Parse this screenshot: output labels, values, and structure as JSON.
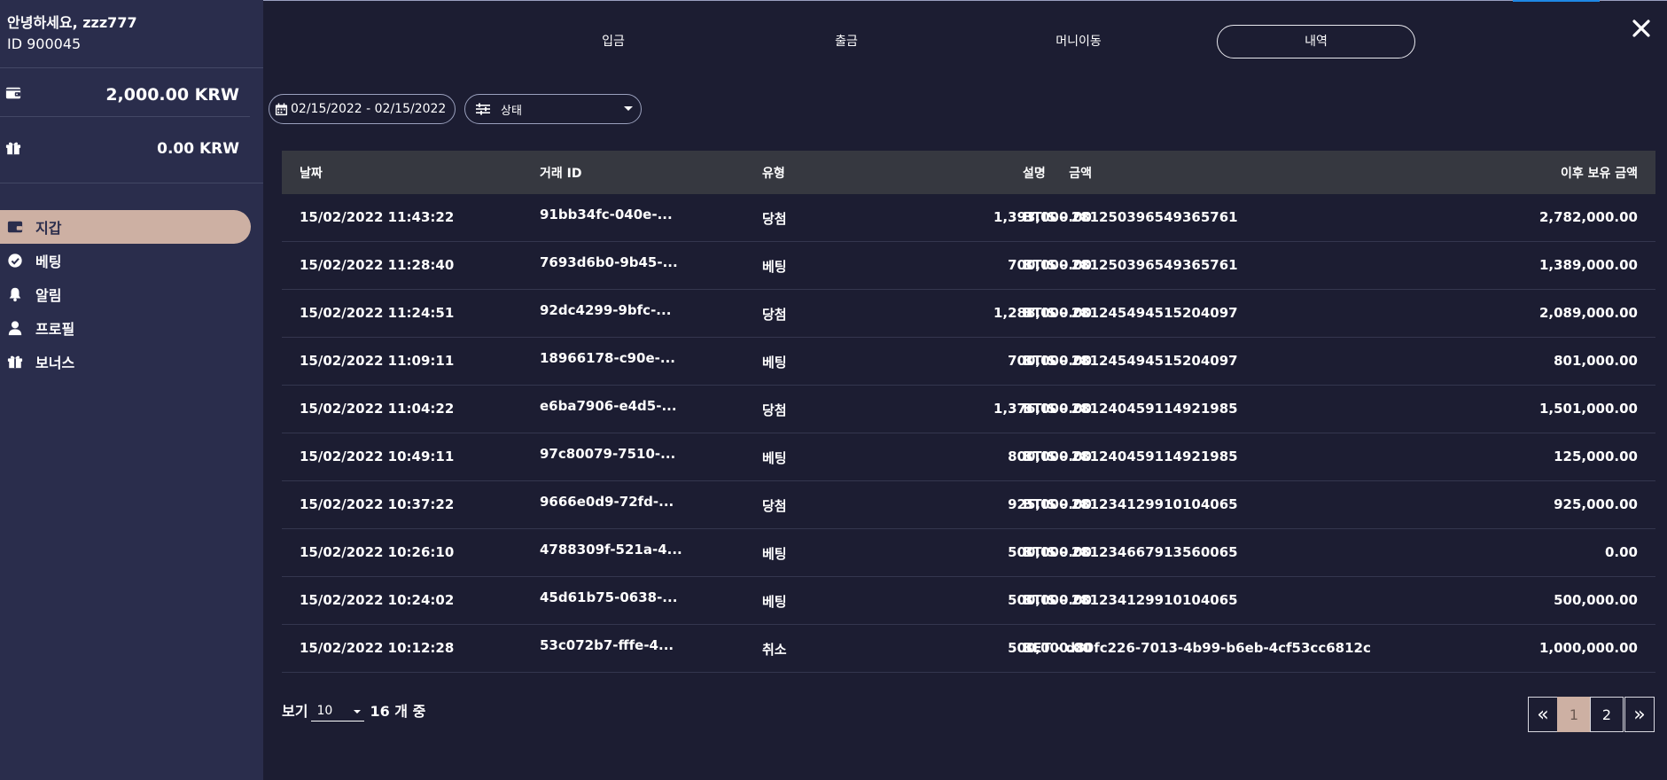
{
  "user": {
    "greeting": "안녕하세요, zzz777",
    "id_label": "ID 900045"
  },
  "balances": {
    "main": "2,000.00 KRW",
    "bonus": "0.00 KRW"
  },
  "sidebar": {
    "items": [
      {
        "label": "지갑",
        "icon": "wallet-icon",
        "active": true
      },
      {
        "label": "베팅",
        "icon": "check-circle-icon",
        "active": false
      },
      {
        "label": "알림",
        "icon": "bell-icon",
        "active": false
      },
      {
        "label": "프로필",
        "icon": "user-icon",
        "active": false
      },
      {
        "label": "보너스",
        "icon": "gift-icon",
        "active": false
      }
    ]
  },
  "tabs": [
    {
      "label": "입금",
      "active": false
    },
    {
      "label": "출금",
      "active": false
    },
    {
      "label": "머니이동",
      "active": false
    },
    {
      "label": "내역",
      "active": true
    }
  ],
  "filters": {
    "date_range": "02/15/2022 - 02/15/2022",
    "status": "상태"
  },
  "table": {
    "headers": [
      "날짜",
      "거래 ID",
      "유형",
      "금액",
      "설명",
      "이후 보유 금액"
    ],
    "rows": [
      [
        "15/02/2022 11:43:22",
        "91bb34fc-040e-...",
        "당첨",
        "1,393,000.00",
        "BTIS - 281250396549365761",
        "2,782,000.00"
      ],
      [
        "15/02/2022 11:28:40",
        "7693d6b0-9b45-...",
        "베팅",
        "700,000.00",
        "BTIS - 281250396549365761",
        "1,389,000.00"
      ],
      [
        "15/02/2022 11:24:51",
        "92dc4299-9bfc-...",
        "당첨",
        "1,288,000.00",
        "BTIS - 281245494515204097",
        "2,089,000.00"
      ],
      [
        "15/02/2022 11:09:11",
        "18966178-c90e-...",
        "베팅",
        "700,000.00",
        "BTIS - 281245494515204097",
        "801,000.00"
      ],
      [
        "15/02/2022 11:04:22",
        "e6ba7906-e4d5-...",
        "당첨",
        "1,376,000.00",
        "BTIS - 281240459114921985",
        "1,501,000.00"
      ],
      [
        "15/02/2022 10:49:11",
        "97c80079-7510-...",
        "베팅",
        "800,000.00",
        "BTIS - 281240459114921985",
        "125,000.00"
      ],
      [
        "15/02/2022 10:37:22",
        "9666e0d9-72fd-...",
        "당첨",
        "925,000.00",
        "BTIS - 281234129910104065",
        "925,000.00"
      ],
      [
        "15/02/2022 10:26:10",
        "4788309f-521a-4...",
        "베팅",
        "500,000.00",
        "BTIS - 281234667913560065",
        "0.00"
      ],
      [
        "15/02/2022 10:24:02",
        "45d61b75-0638-...",
        "베팅",
        "500,000.00",
        "BTIS - 281234129910104065",
        "500,000.00"
      ],
      [
        "15/02/2022 10:12:28",
        "53c072b7-fffe-4...",
        "취소",
        "500,000.00",
        "BET - d80fc226-7013-4b99-b6eb-4cf53cc6812c",
        "1,000,000.00"
      ]
    ]
  },
  "footer": {
    "show_label": "보기",
    "page_size": "10",
    "total_label": "16 개 중",
    "pager": {
      "prev": "«",
      "pages": [
        "1",
        "2"
      ],
      "current": "1",
      "next": "»"
    }
  },
  "colors": {
    "sidebar_bg": "#2a2d4c",
    "main_bg": "#1c1d32",
    "accent": "#cdb0a3",
    "header_bg": "#363840"
  }
}
